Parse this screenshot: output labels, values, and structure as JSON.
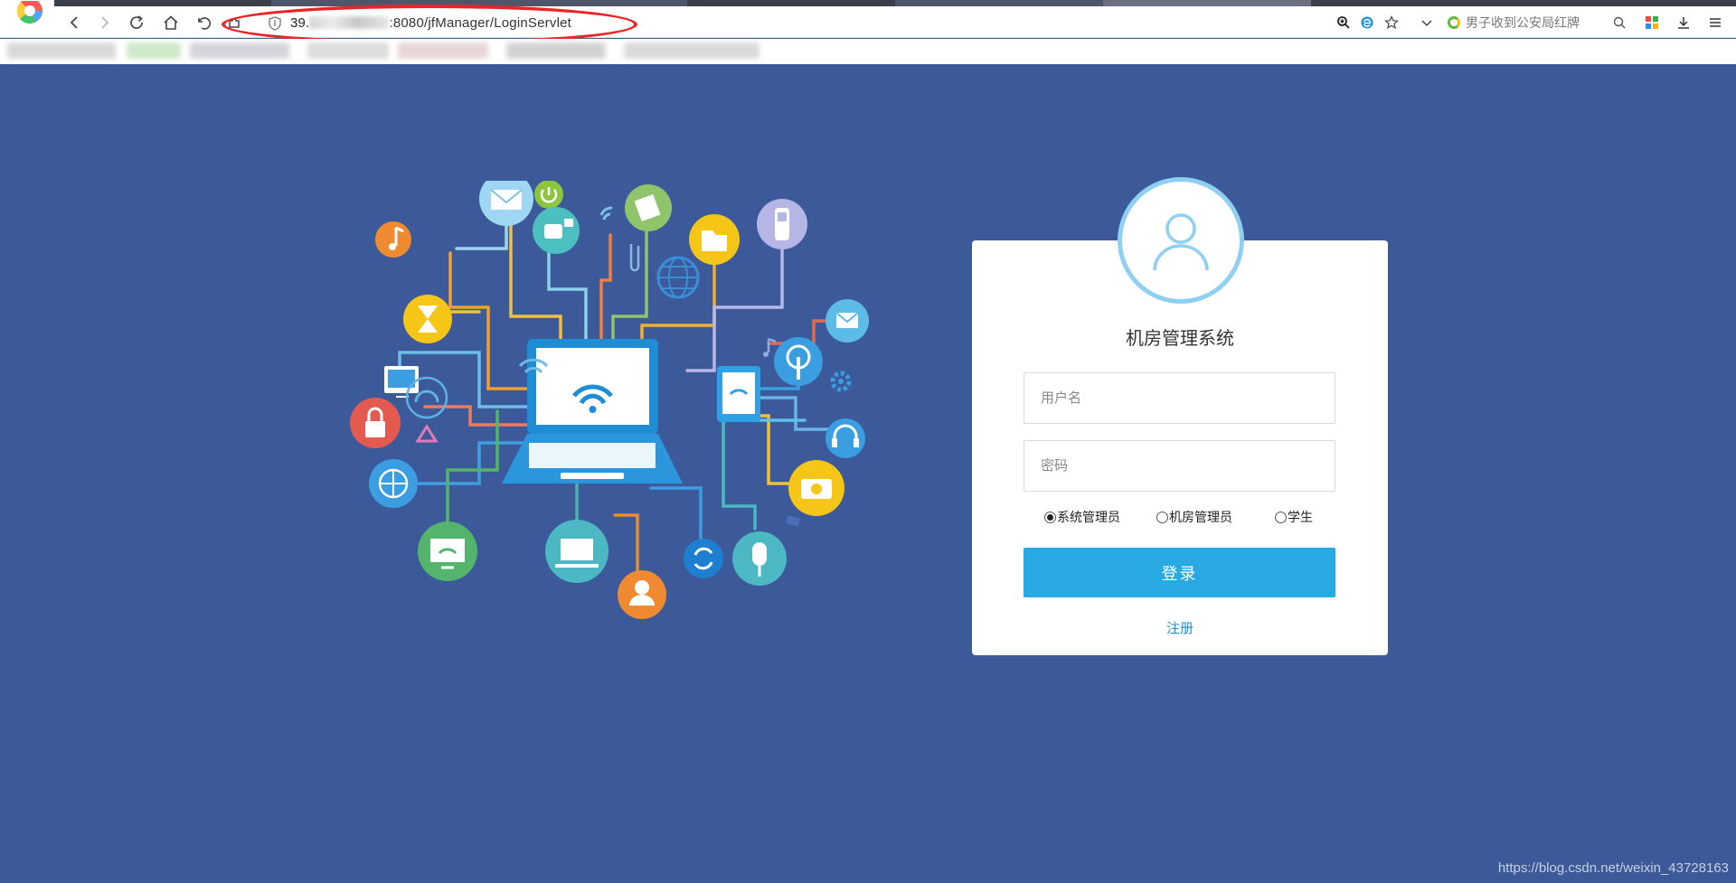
{
  "browser": {
    "url_host_prefix": "39.",
    "url_path": ":8080/jfManager/LoginServlet",
    "news_text": "男子收到公安局红牌",
    "logo_icon": "browser-logo-icon"
  },
  "colors": {
    "page_background": "#3c5a99",
    "card_background": "#ffffff",
    "button_background": "#29a9e1",
    "avatar_ring": "#8fd0f2",
    "link_color": "#1a8fd6",
    "annotation_red": "#e8262a"
  },
  "login": {
    "system_title": "机房管理系统",
    "username_placeholder": "用户名",
    "password_placeholder": "密码",
    "roles": [
      {
        "label": "系统管理员",
        "checked": true
      },
      {
        "label": "机房管理员",
        "checked": false
      },
      {
        "label": "学生",
        "checked": false
      }
    ],
    "login_button": "登录",
    "register_link": "注册"
  },
  "footer": {
    "watermark": "https://blog.csdn.net/weixin_43728163"
  }
}
